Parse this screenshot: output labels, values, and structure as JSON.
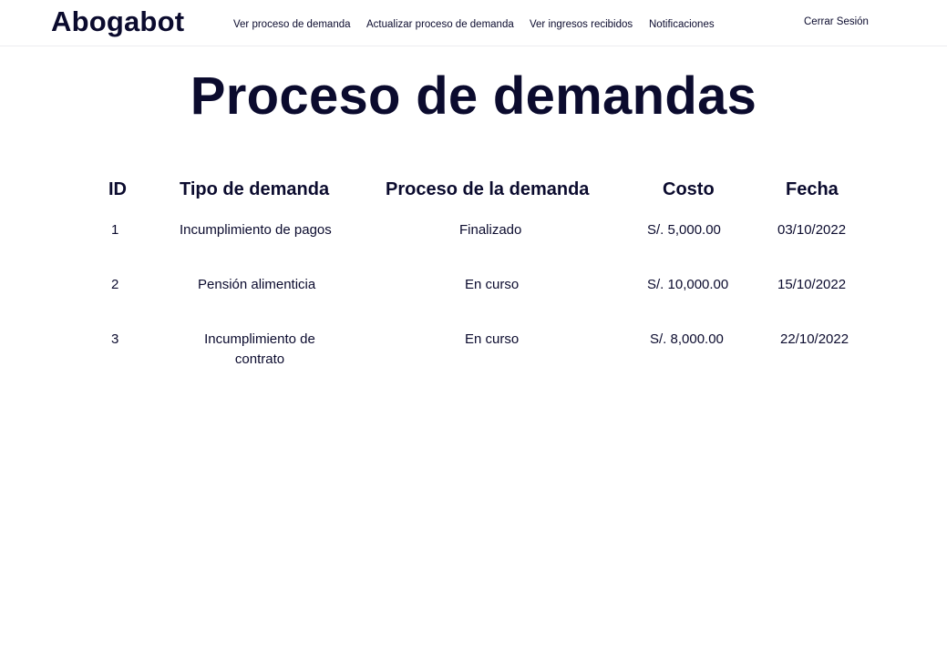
{
  "app": {
    "brand": "Abogabot"
  },
  "nav": {
    "items": [
      {
        "label": "Ver proceso de demanda"
      },
      {
        "label": "Actualizar proceso de demanda"
      },
      {
        "label": "Ver ingresos recibidos"
      },
      {
        "label": "Notificaciones"
      }
    ],
    "logout_label": "Cerrar Sesión"
  },
  "main": {
    "title": "Proceso de demandas",
    "table": {
      "columns": [
        "ID",
        "Tipo de demanda",
        "Proceso de la demanda",
        "Costo",
        "Fecha"
      ],
      "rows": [
        {
          "id": "1",
          "tipo": "Incumplimiento de pagos",
          "proceso": "Finalizado",
          "costo": "S/. 5,000.00",
          "fecha": "03/10/2022"
        },
        {
          "id": "2",
          "tipo": "Pensión alimenticia",
          "proceso": "En curso",
          "costo": "S/. 10,000.00",
          "fecha": "15/10/2022"
        },
        {
          "id": "3",
          "tipo": "Incumplimiento de contrato",
          "proceso": "En curso",
          "costo": "S/. 8,000.00",
          "fecha": "22/10/2022"
        }
      ]
    }
  },
  "colors": {
    "text": "#0b0b2e",
    "background": "#ffffff"
  }
}
